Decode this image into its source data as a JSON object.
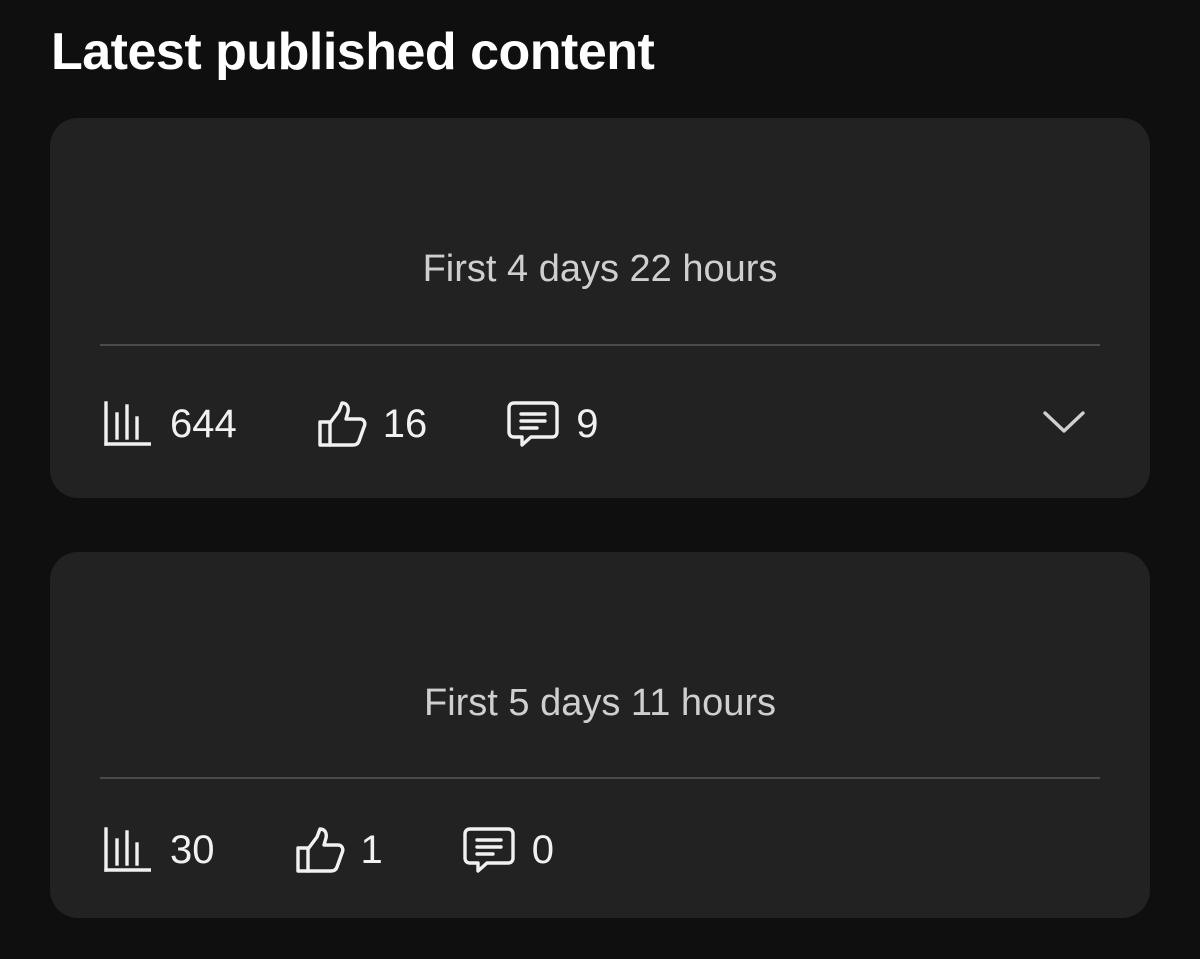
{
  "section": {
    "title": "Latest published content"
  },
  "items": [
    {
      "period": "First 4 days 22 hours",
      "views": "644",
      "likes": "16",
      "comments": "9",
      "expandable": true
    },
    {
      "period": "First 5 days 11 hours",
      "views": "30",
      "likes": "1",
      "comments": "0",
      "expandable": false
    }
  ],
  "icons": {
    "views": "bar-chart-icon",
    "likes": "thumbs-up-icon",
    "comments": "comment-icon",
    "expand": "chevron-down-icon"
  },
  "colors": {
    "background": "#0f0f0f",
    "card": "#222222",
    "text": "#f1f1f1",
    "muted_text": "#cfcfcf",
    "divider": "#4a4a4a"
  }
}
